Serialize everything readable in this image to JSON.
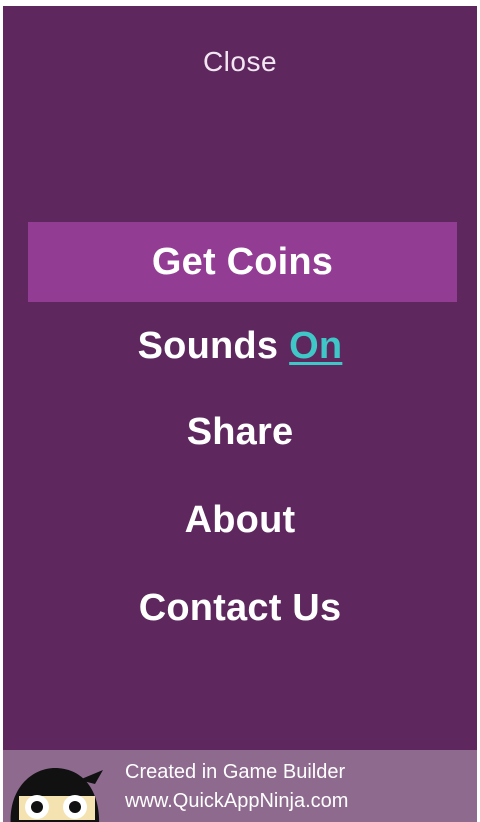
{
  "header": {
    "close_label": "Close"
  },
  "menu": {
    "get_coins": "Get Coins",
    "sounds_label": "Sounds",
    "sounds_state": "On",
    "share": "Share",
    "about": "About",
    "contact_us": "Contact Us"
  },
  "footer": {
    "line1": "Created in Game Builder",
    "line2": "www.QuickAppNinja.com",
    "logo_icon": "ninja-icon"
  },
  "colors": {
    "background": "#5e285e",
    "highlight": "#933c93",
    "toggle_on": "#3fc7c7",
    "footer": "#8f6a8f"
  }
}
